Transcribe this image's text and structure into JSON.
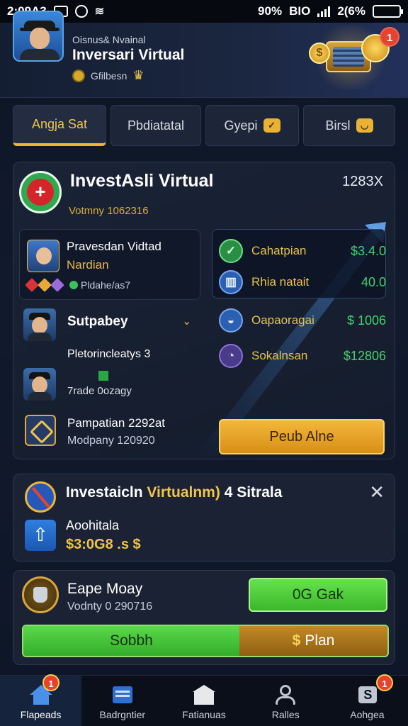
{
  "status_bar": {
    "time": "2:09A3",
    "battery_text": "90%",
    "network_text": "BIO",
    "right_percent": "2(6%",
    "battery_level": 0.9
  },
  "header": {
    "subtitle": "Oisnus& Nvainal",
    "title": "Inversari Virtual",
    "meta": "Gfilbesn",
    "notification_count": "1"
  },
  "tabs": [
    {
      "label": "Angja Sat",
      "active": true
    },
    {
      "label": "Pbdiatatal",
      "active": false
    },
    {
      "label": "Gyepi",
      "active": false,
      "icon": "check-box-icon"
    },
    {
      "label": "Birsl",
      "active": false,
      "icon": "smile-box-icon"
    }
  ],
  "main": {
    "title": "InvestAsli Virtual",
    "value": "1283X",
    "subtitle": "Votmny 1062316",
    "subcard": {
      "line1": "Pravesdan Vidtad",
      "line2": "Nardian",
      "meta": "Pldahe/as7"
    },
    "sponsor_title": "Sutpabey",
    "row1": "Pletorincleatys 3",
    "row2": "7rade 0ozagy",
    "row3": "Pampatian 2292at",
    "row4": "Modpany 120920",
    "stats": [
      {
        "label": "Cahatpian",
        "value": "$3.4.0",
        "icon": "check-icon"
      },
      {
        "label": "Rhia natait",
        "value": "40.0",
        "icon": "basket-icon"
      },
      {
        "label": "Oapaoragai",
        "value": "$ 1006",
        "icon": "bowl-icon"
      },
      {
        "label": "Sokalnsan",
        "value": "$12806",
        "icon": "chart-circle-icon"
      }
    ],
    "push_button": "Peub Alne"
  },
  "promo": {
    "title_part1": "Investaicln ",
    "title_highlight": "Virtualnm)",
    "title_part2": " 4 Sitrala",
    "label": "Aoohitala",
    "amount": "$3:0G8 .s",
    "amount_suffix": "$"
  },
  "bonus": {
    "title": "Eape Moay",
    "subtitle": "Vodnty 0 290716",
    "green_button": "0G Gak",
    "split_left": "Sobbh",
    "split_right_symbol": "$",
    "split_right": "Plan"
  },
  "bottom_nav": [
    {
      "label": "Flapeads",
      "active": true,
      "badge": "1"
    },
    {
      "label": "Badrgntier",
      "active": false,
      "badge": ""
    },
    {
      "label": "Fatianuas",
      "active": false,
      "badge": ""
    },
    {
      "label": "Ralles",
      "active": false,
      "badge": ""
    },
    {
      "label": "Aohgea",
      "active": false,
      "badge": "1"
    }
  ],
  "colors": {
    "accent_gold": "#f1c44a",
    "accent_green": "#46d06a",
    "background": "#111a2c",
    "badge_red": "#e5432f"
  }
}
